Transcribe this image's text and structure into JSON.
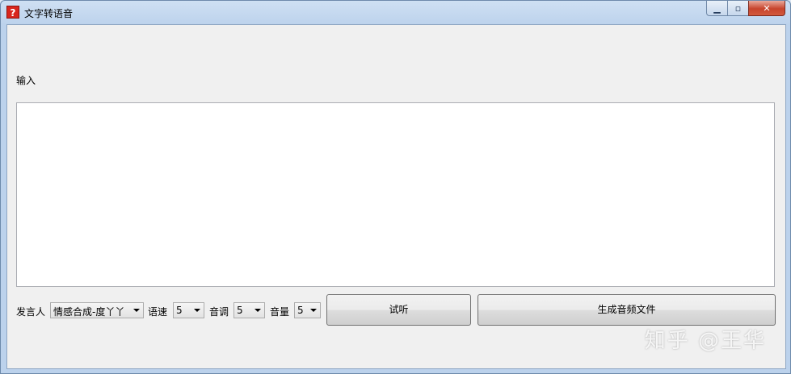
{
  "window": {
    "title": "文字转语音",
    "icon": "question-mark-icon",
    "minimize_glyph": "▁",
    "maximize_glyph": "▫",
    "close_glyph": "✕"
  },
  "form": {
    "input_label": "输入",
    "input_value": "",
    "speaker_label": "发言人",
    "speaker_value": "情感合成-度丫丫",
    "speed_label": "语速",
    "speed_value": "5",
    "pitch_label": "音调",
    "pitch_value": "5",
    "volume_label": "音量",
    "volume_value": "5",
    "preview_button": "试听",
    "generate_button": "生成音频文件"
  },
  "overlay": {
    "watermark": "知乎 @王华"
  }
}
